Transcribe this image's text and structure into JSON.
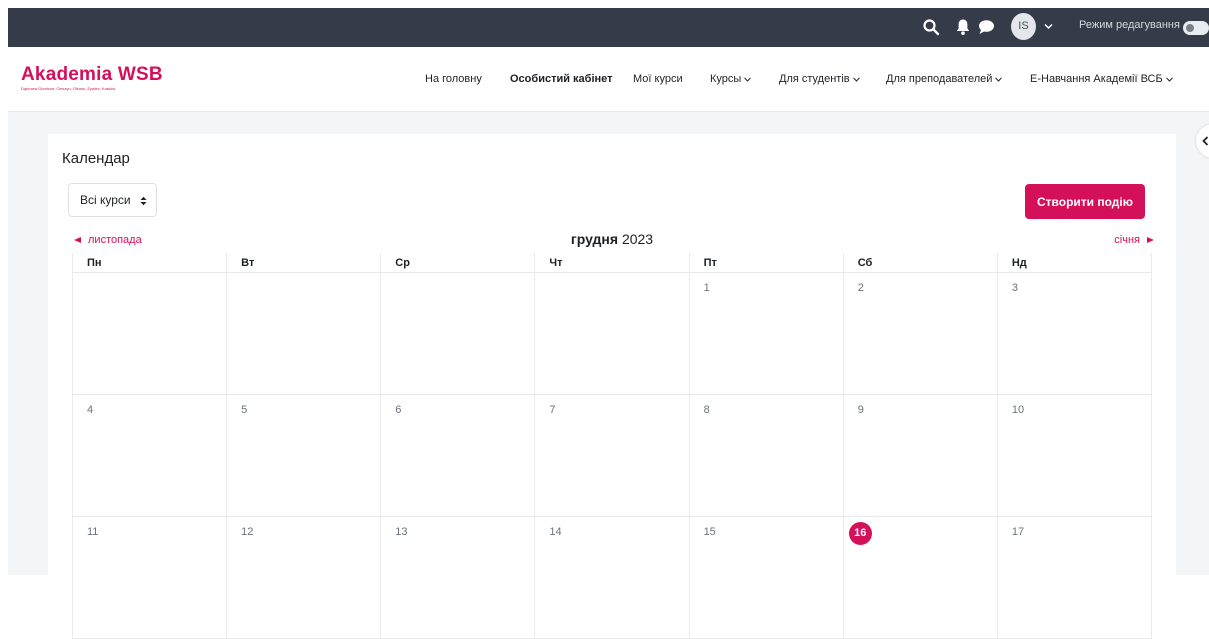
{
  "topbar": {
    "avatar_initials": "IS",
    "edit_mode_label": "Режим редагування"
  },
  "brand": {
    "name": "Akademia WSB",
    "tagline": "Dąbrowa Górnicza, Cieszyn, Olkusz, Żywiec, Kraków",
    "color": "#d5105b"
  },
  "nav": {
    "items": [
      {
        "label": "На головну",
        "dropdown": false,
        "active": false
      },
      {
        "label": "Особистий кабінет",
        "dropdown": false,
        "active": true
      },
      {
        "label": "Мої курси",
        "dropdown": false,
        "active": false
      },
      {
        "label": "Курсы",
        "dropdown": true,
        "active": false
      },
      {
        "label": "Для студентів",
        "dropdown": true,
        "active": false
      },
      {
        "label": "Для преподавателей",
        "dropdown": true,
        "active": false
      },
      {
        "label": "E-Навчання Академії ВСБ",
        "dropdown": true,
        "active": false
      }
    ]
  },
  "calendar": {
    "page_title": "Календар",
    "course_filter": "Всі курси",
    "create_button": "Створити подію",
    "prev_month": "листопада",
    "next_month": "січня",
    "month_name": "грудня",
    "year": "2023",
    "weekdays": [
      "Пн",
      "Вт",
      "Ср",
      "Чт",
      "Пт",
      "Сб",
      "Нд"
    ],
    "weeks": [
      [
        "",
        "",
        "",
        "",
        "1",
        "2",
        "3"
      ],
      [
        "4",
        "5",
        "6",
        "7",
        "8",
        "9",
        "10"
      ],
      [
        "11",
        "12",
        "13",
        "14",
        "15",
        "16",
        "17"
      ]
    ],
    "today": "16"
  }
}
